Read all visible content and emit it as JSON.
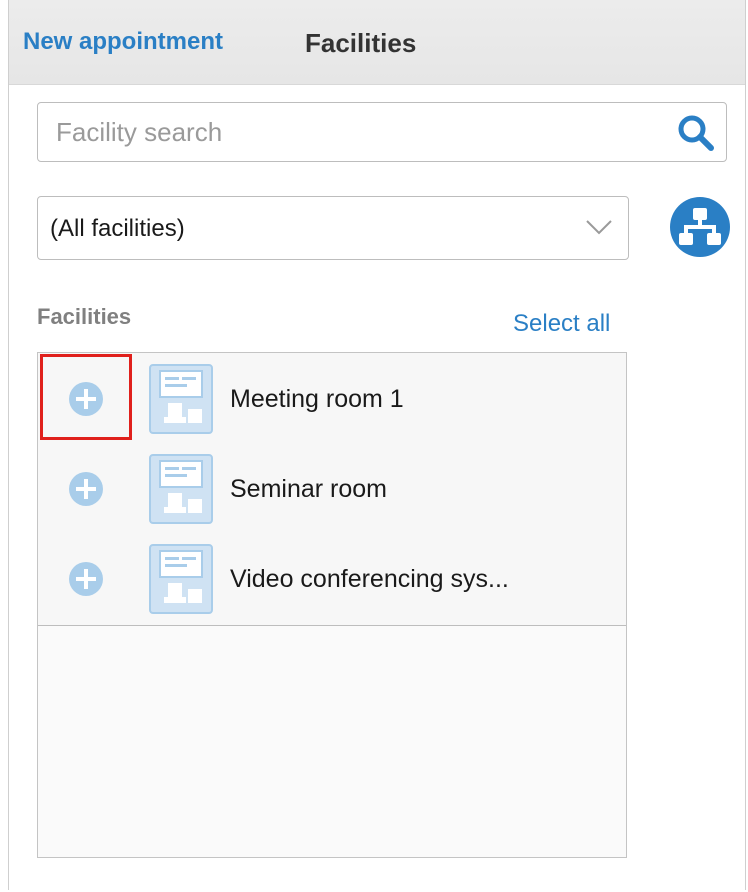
{
  "header": {
    "back_label": "New appointment",
    "title": "Facilities"
  },
  "search": {
    "placeholder": "Facility search",
    "value": "",
    "icon": "search-icon"
  },
  "filter": {
    "selected": "(All facilities)",
    "tree_icon": "org-tree-icon"
  },
  "facilities_section": {
    "label": "Facilities",
    "select_all_label": "Select all",
    "items": [
      {
        "name": "Meeting room 1"
      },
      {
        "name": "Seminar room"
      },
      {
        "name": "Video conferencing sys..."
      }
    ]
  },
  "colors": {
    "accent": "#2a7fc5",
    "icon_fill": "#a9cdea",
    "highlight": "#e0201c"
  }
}
